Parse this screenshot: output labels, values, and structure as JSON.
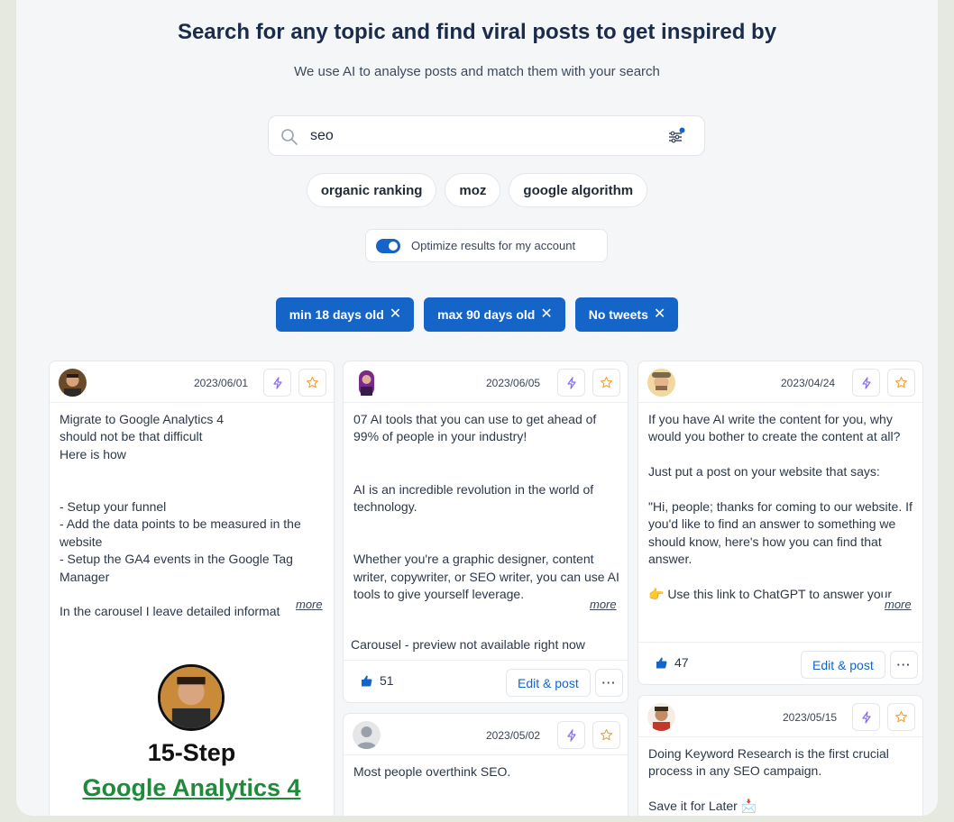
{
  "header": {
    "title": "Search for any topic and find viral posts to get inspired by",
    "subtitle": "We use AI to analyse posts and match them with your search"
  },
  "search": {
    "value": "seo",
    "placeholder": ""
  },
  "suggestions": [
    "organic ranking",
    "moz",
    "google algorithm"
  ],
  "optimize": {
    "label": "Optimize results for my account",
    "enabled": true
  },
  "filters": [
    "min 18 days old",
    "max 90 days old",
    "No tweets"
  ],
  "cards": [
    {
      "date": "2023/06/01",
      "text": "Migrate to Google Analytics 4\nshould not be that difficult\nHere is how\n\n\n- Setup your funnel\n- Add the data points to be measured in the website\n- Setup the GA4 events in the Google Tag Manager\n\nIn the carousel I leave detailed informat",
      "more": "more",
      "preview_title": "15-Step",
      "preview_subtitle": "Google Analytics 4"
    },
    {
      "date": "2023/06/05",
      "text": "07 AI tools that you can use to get ahead of 99% of people in your industry!\n\n\nAI is an incredible revolution in the world of technology.\n\n\nWhether you're a graphic designer, content writer, copywriter, or SEO writer, you can use AI tools to give yourself leverage.",
      "more": "more",
      "note": "Carousel - preview not available right now",
      "likes": "51",
      "edit_label": "Edit & post",
      "dots": "···"
    },
    {
      "date": "2023/04/24",
      "text": "If you have AI write the content for you, why would you bother to create the content at all?\n\nJust put a post on your website that says:\n\n\"Hi, people; thanks for coming to our website. If you'd like to find an answer to something we should know, here's how you can find that answer.\n\n👉 Use this link to ChatGPT to answer your",
      "more": "more",
      "likes": "47",
      "edit_label": "Edit & post",
      "dots": "···"
    },
    {
      "date": "2023/05/02",
      "text": "Most people overthink SEO."
    },
    {
      "date": "2023/05/15",
      "text": "Doing Keyword Research is the first crucial process in any SEO campaign.\n\nSave it for Later 📩"
    }
  ],
  "colors": {
    "accent": "#1565c9",
    "page_bg": "#f5f6f7",
    "frame": "#e6e9df",
    "preview_green": "#1f8a3a"
  },
  "icons": [
    "search-icon",
    "filter-icon",
    "close-icon",
    "lightning-icon",
    "star-icon",
    "thumbs-up-icon",
    "more-dots-icon"
  ]
}
